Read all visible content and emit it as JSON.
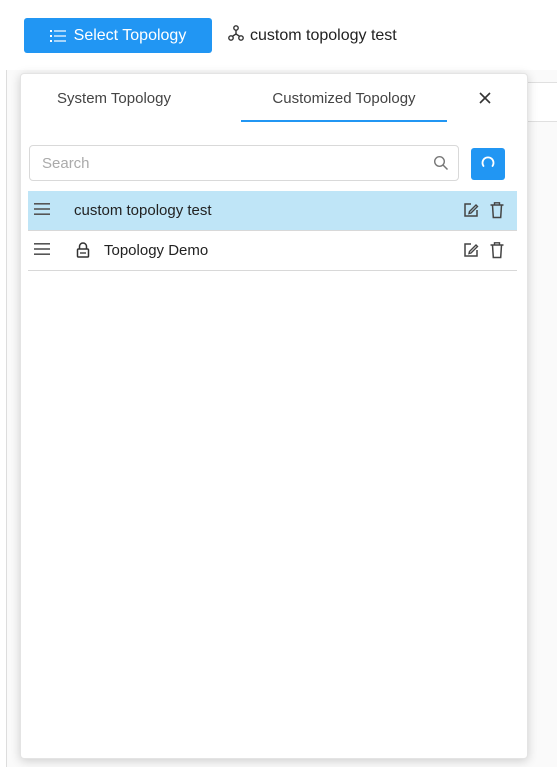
{
  "toolbar": {
    "select_label": "Select Topology",
    "current_topology": "custom topology test",
    "accent_color": "#2196f3"
  },
  "panel": {
    "tabs": [
      {
        "label": "System Topology",
        "active": false
      },
      {
        "label": "Customized Topology",
        "active": true
      }
    ],
    "close_icon": "close-icon",
    "search": {
      "placeholder": "Search",
      "value": ""
    },
    "refresh_icon": "refresh-icon",
    "items": [
      {
        "name": "custom topology test",
        "locked": false,
        "selected": true
      },
      {
        "name": "Topology Demo",
        "locked": true,
        "selected": false
      }
    ],
    "selected_row_color": "#bfe5f7"
  }
}
